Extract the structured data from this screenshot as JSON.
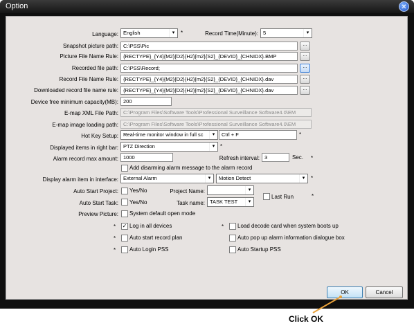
{
  "window": {
    "title": "Option",
    "close_glyph": "✕"
  },
  "labels": {
    "language": "Language:",
    "record_time": "Record Time(Minute):",
    "snapshot_path": "Snapshot picture path:",
    "picture_rule": "Picture File Name Rule:",
    "record_path": "Recorded file  path:",
    "record_rule": "Record File Name Rule:",
    "download_rule": "Downloaded record file name rule:",
    "free_capacity": "Device free minimum capacity(MB):",
    "emap_xml": "E-map XML File Path:",
    "emap_image": "E-map image loading path:",
    "hotkey": "Hot Key Setup:",
    "right_bar": "Displayed items in right bar:",
    "alarm_max": "Alarm record max amount:",
    "refresh": "Refresh interval:",
    "sec": "Sec.",
    "alarm_item": "Display alarm item in interface:",
    "auto_project": "Auto Start Project:",
    "project_name": "Project Name:",
    "auto_task": "Auto Start Task:",
    "task_name": "Task name:",
    "preview": "Preview Picture:"
  },
  "values": {
    "language": "English",
    "record_time": "5",
    "snapshot_path": "C:\\PSS\\Pic",
    "picture_rule": "{RECTYPE}_{Y4}{M2}{D2}{H2}{m2}{S2}_{DEVID}_{CHNIDX}.BMP",
    "record_path": "C:\\PSS\\Record;",
    "record_rule": "{RECTYPE}_{Y4}{M2}{D2}{H2}{m2}{S2}_{DEVID}_{CHNIDX}.dav",
    "download_rule": "{RECTYPE}_{Y4}{M2}{D2}{H2}{m2}{S2}_{DEVID}_{CHNIDX}.dav",
    "free_capacity": "200",
    "emap_xml": "C:\\Program Files\\Software Tools\\Professional Surveillance Software4.0\\EM",
    "emap_image": "C:\\Program Files\\Software Tools\\Professional Surveillance Software4.0\\EM",
    "hotkey_target": "Real-time monitor window in full sc",
    "hotkey_keys": "Ctrl + F",
    "right_bar": "PTZ Direction",
    "alarm_max": "1000",
    "refresh": "3",
    "alarm_item_1": "External Alarm",
    "alarm_item_2": "Motion Detect",
    "project_name": "",
    "task_name": "TASK TEST"
  },
  "checkboxes": {
    "add_disarming": {
      "label": "Add disarming alarm message to the alarm record",
      "checked": false
    },
    "auto_project": {
      "label": "Yes/No",
      "checked": false
    },
    "auto_task": {
      "label": "Yes/No",
      "checked": false
    },
    "last_run": {
      "label": "Last Run",
      "checked": false
    },
    "system_open": {
      "label": "System default open mode",
      "checked": false
    },
    "log_all": {
      "label": "Log in all devices",
      "checked": true
    },
    "decode_card": {
      "label": "Load decode card when system boots up",
      "checked": false
    },
    "auto_record": {
      "label": "Auto start record plan",
      "checked": false
    },
    "auto_popup": {
      "label": "Auto pop up alarm information dialogue box",
      "checked": false
    },
    "auto_login": {
      "label": "Auto Login PSS",
      "checked": false
    },
    "auto_startup": {
      "label": "Auto Startup PSS",
      "checked": false
    }
  },
  "glyphs": {
    "star": "*",
    "browse": "...",
    "arrow": "▾",
    "check": "✓"
  },
  "buttons": {
    "ok": "OK",
    "cancel": "Cancel"
  },
  "annotation": {
    "callout": "Click OK",
    "color": "#e8a13a"
  }
}
